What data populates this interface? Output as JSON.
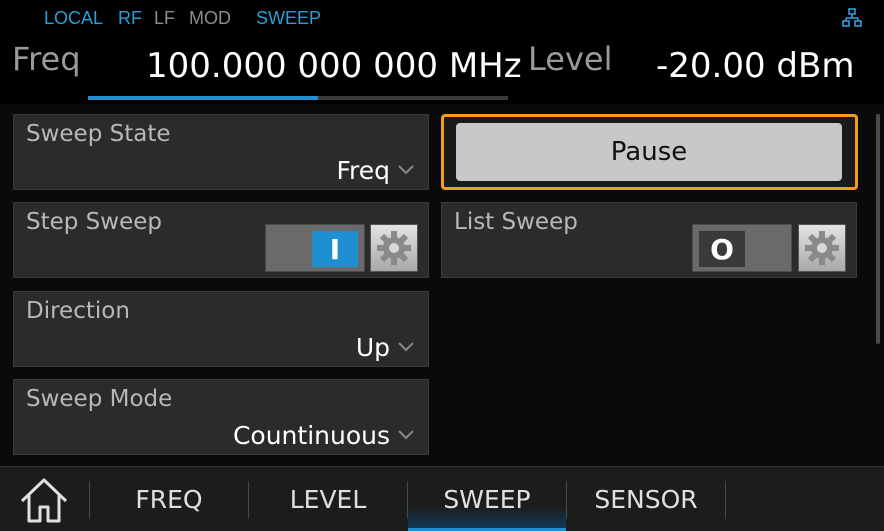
{
  "status": {
    "local": "LOCAL",
    "rf": "RF",
    "lf": "LF",
    "mod": "MOD",
    "sweep": "SWEEP"
  },
  "header": {
    "freq_label": "Freq",
    "freq_value": "100.000 000 000 MHz",
    "level_label": "Level",
    "level_value": "-20.00  dBm"
  },
  "cards": {
    "sweep_state": {
      "title": "Sweep State",
      "value": "Freq"
    },
    "step_sweep": {
      "title": "Step Sweep",
      "state": "I"
    },
    "direction": {
      "title": "Direction",
      "value": "Up"
    },
    "sweep_mode": {
      "title": "Sweep Mode",
      "value": "Countinuous"
    },
    "pause": {
      "label": "Pause"
    },
    "list_sweep": {
      "title": "List Sweep",
      "state": "O"
    }
  },
  "nav": {
    "tabs": [
      {
        "label": "FREQ"
      },
      {
        "label": "LEVEL"
      },
      {
        "label": "SWEEP"
      },
      {
        "label": "SENSOR"
      }
    ],
    "active": "SWEEP"
  },
  "colors": {
    "accent": "#1e8fd0",
    "focus": "#f0a018",
    "status_on": "#2a9fd8",
    "status_off": "#8c8c8c"
  },
  "icons": [
    "network-icon",
    "chevron-down-icon",
    "gear-icon",
    "home-icon"
  ]
}
